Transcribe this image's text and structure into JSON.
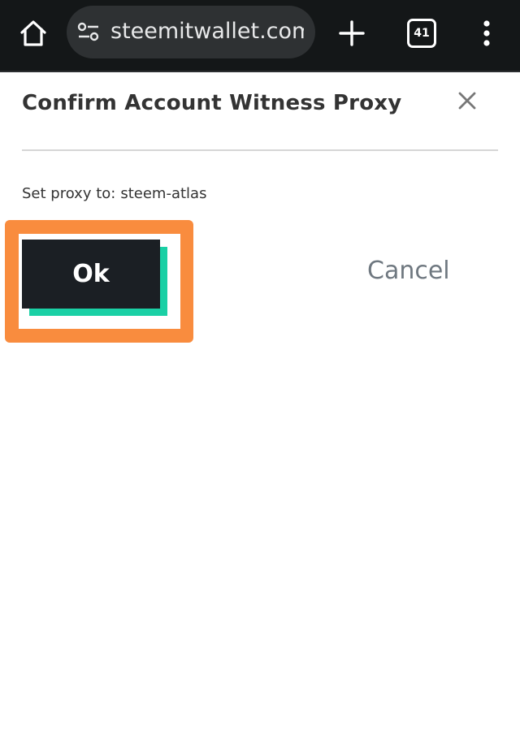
{
  "browser": {
    "url": "steemitwallet.com/-",
    "tab_count": "41",
    "icons": [
      "home-icon",
      "site-settings-icon",
      "plus-icon",
      "tabs-icon",
      "more-vert-icon"
    ]
  },
  "dialog": {
    "title": "Confirm Account Witness Proxy",
    "proxy_label": "Set proxy to:",
    "proxy_value": "steem-atlas",
    "ok_label": "Ok",
    "cancel_label": "Cancel",
    "close_icon": "close-icon"
  },
  "colors": {
    "browser_bar": "#141718",
    "url_box": "#2e3133",
    "ok_background": "#1b1f24",
    "ok_accent": "#1ad0a5",
    "highlight": "#f98c3e",
    "cancel_text": "#6f7880"
  }
}
